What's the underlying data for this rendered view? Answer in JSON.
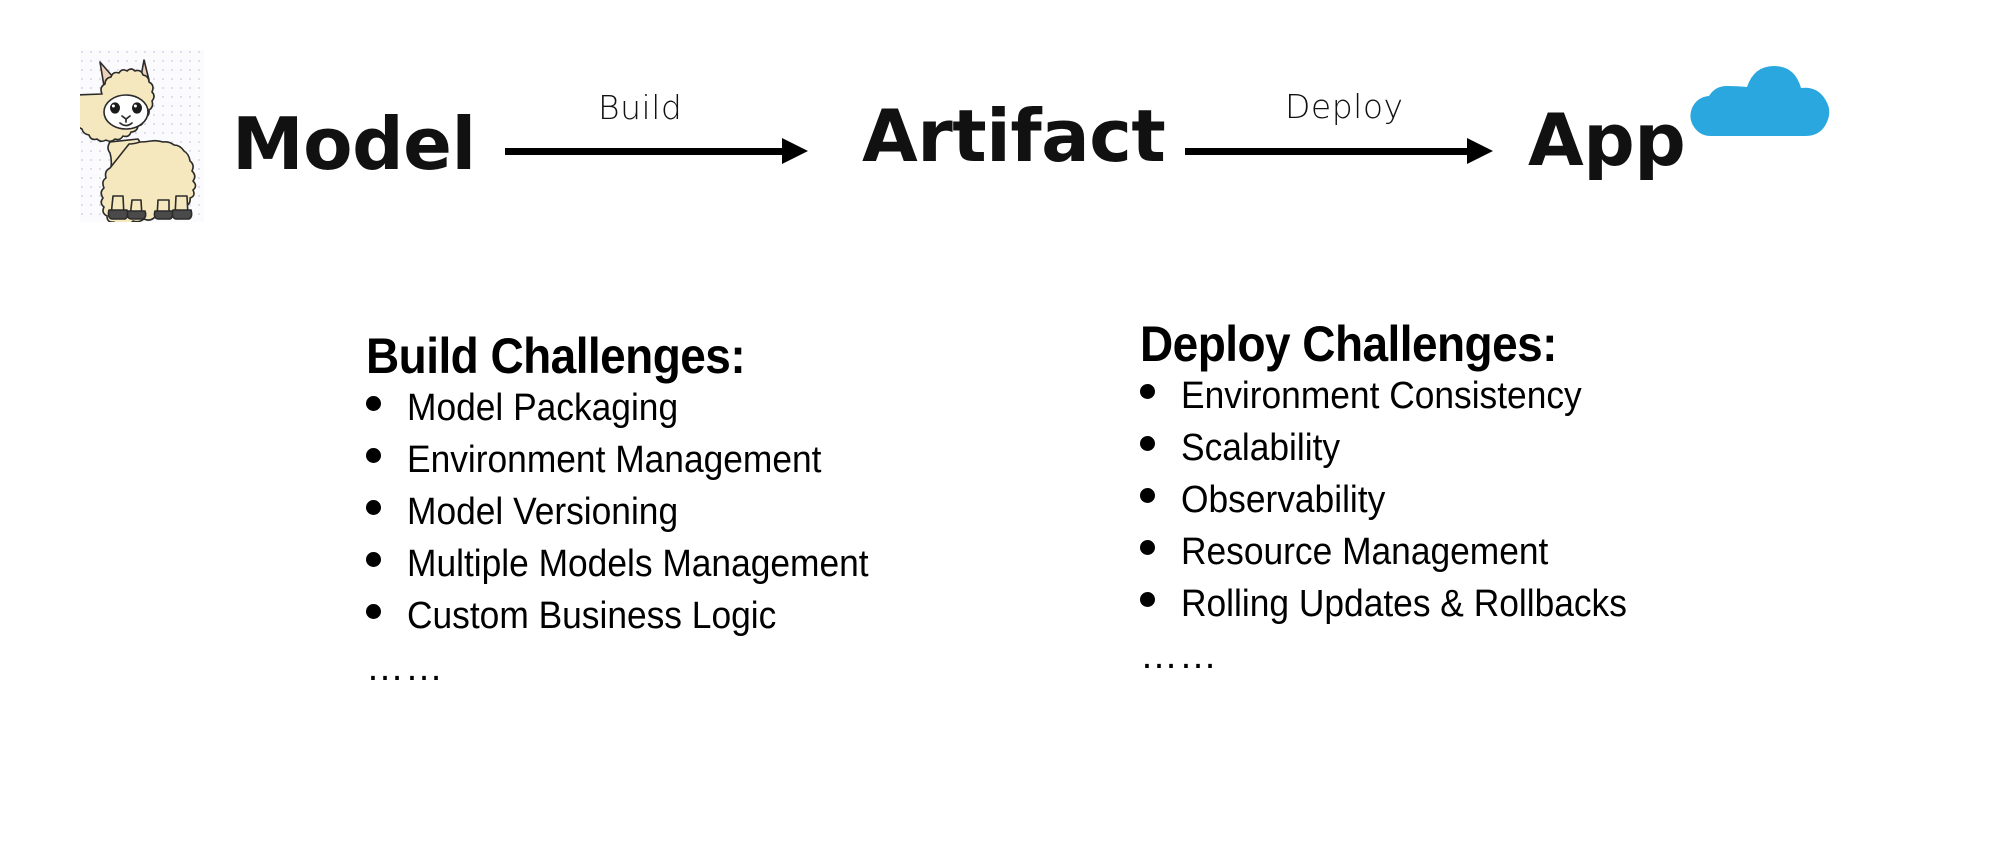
{
  "pipeline": {
    "stages": [
      {
        "id": "model",
        "label": "Model",
        "icon": "llama-icon"
      },
      {
        "id": "artifact",
        "label": "Artifact",
        "icon": null
      },
      {
        "id": "app",
        "label": "App",
        "icon": "cloud-icon"
      }
    ],
    "arrows": [
      {
        "id": "build",
        "label": "Build"
      },
      {
        "id": "deploy",
        "label": "Deploy"
      }
    ]
  },
  "columns": {
    "build": {
      "heading": "Build Challenges:",
      "items": [
        "Model Packaging",
        "Environment Management",
        "Model Versioning",
        "Multiple Models Management",
        "Custom Business Logic"
      ],
      "ellipsis": "……"
    },
    "deploy": {
      "heading": "Deploy Challenges:",
      "items": [
        "Environment Consistency",
        "Scalability",
        "Observability",
        "Resource Management",
        "Rolling Updates & Rollbacks"
      ],
      "ellipsis": "……"
    }
  },
  "colors": {
    "cloud_blue": "#2BA7E0",
    "llama_body": "#F5E8BE",
    "llama_face": "#FFFFFF",
    "llama_hoof": "#4A4A4A",
    "llama_ear_inner": "#EFD2BC",
    "outline": "#2B2B2B",
    "text": "#000000",
    "background": "#FFFFFF"
  }
}
